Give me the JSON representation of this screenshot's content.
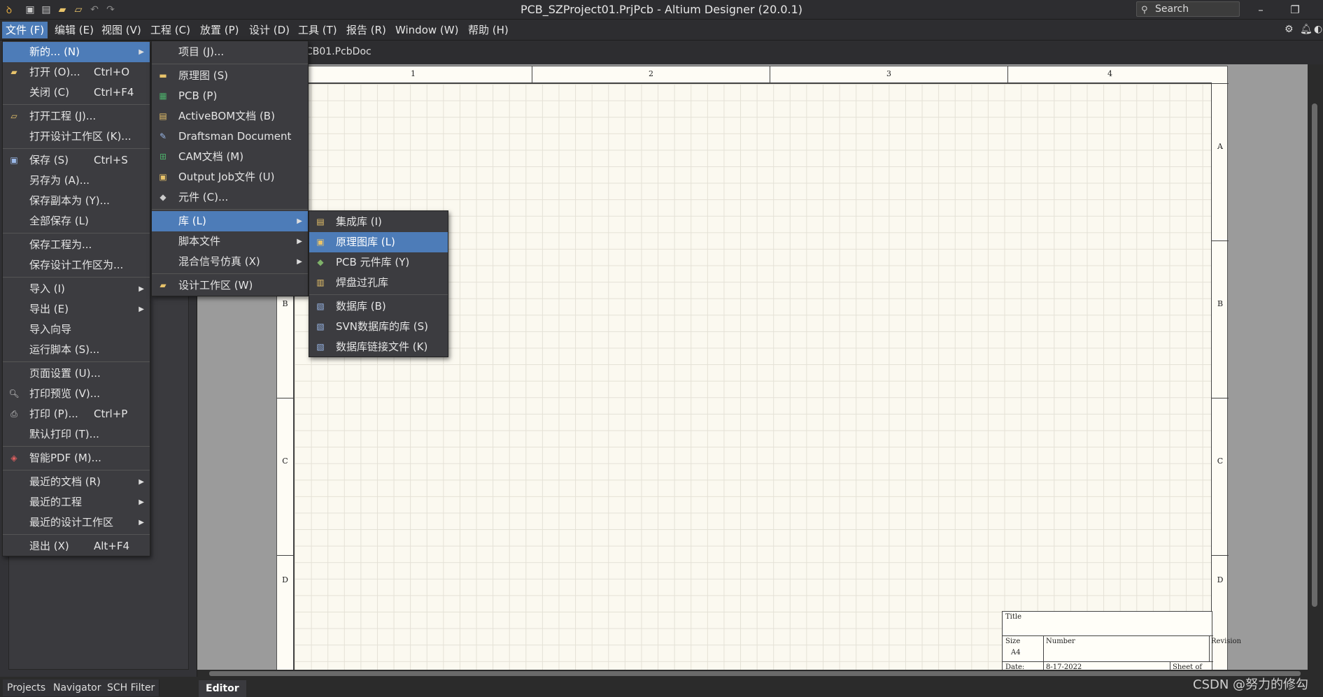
{
  "window": {
    "title": "PCB_SZProject01.PrjPcb - Altium Designer (20.0.1)",
    "search_label": "Search",
    "quick_icons": [
      "save-icon",
      "save-all-icon",
      "open-icon",
      "open-project-icon",
      "undo-icon",
      "redo-icon"
    ]
  },
  "menubar": {
    "items": [
      "文件 (F)",
      "编辑 (E)",
      "视图 (V)",
      "工程 (C)",
      "放置 (P)",
      "设计 (D)",
      "工具 (T)",
      "报告 (R)",
      "Window (W)",
      "帮助 (H)"
    ],
    "active_index": 0
  },
  "file_menu": {
    "items": [
      {
        "label": "新的... (N)",
        "shortcut": "",
        "submenu": true
      },
      {
        "label": "打开 (O)...",
        "shortcut": "Ctrl+O"
      },
      {
        "label": "关闭 (C)",
        "shortcut": "Ctrl+F4"
      },
      {
        "label": "打开工程 (J)...",
        "shortcut": ""
      },
      {
        "label": "打开设计工作区 (K)...",
        "shortcut": ""
      },
      {
        "label": "保存 (S)",
        "shortcut": "Ctrl+S"
      },
      {
        "label": "另存为 (A)...",
        "shortcut": ""
      },
      {
        "label": "保存副本为 (Y)...",
        "shortcut": ""
      },
      {
        "label": "全部保存 (L)",
        "shortcut": ""
      },
      {
        "label": "保存工程为...",
        "shortcut": ""
      },
      {
        "label": "保存设计工作区为...",
        "shortcut": ""
      },
      {
        "label": "导入 (I)",
        "shortcut": "",
        "submenu": true
      },
      {
        "label": "导出 (E)",
        "shortcut": "",
        "submenu": true
      },
      {
        "label": "导入向导",
        "shortcut": ""
      },
      {
        "label": "运行脚本 (S)...",
        "shortcut": ""
      },
      {
        "label": "页面设置 (U)...",
        "shortcut": ""
      },
      {
        "label": "打印预览 (V)...",
        "shortcut": ""
      },
      {
        "label": "打印 (P)...",
        "shortcut": "Ctrl+P"
      },
      {
        "label": "默认打印 (T)...",
        "shortcut": ""
      },
      {
        "label": "智能PDF (M)...",
        "shortcut": ""
      },
      {
        "label": "最近的文档 (R)",
        "shortcut": "",
        "submenu": true
      },
      {
        "label": "最近的工程",
        "shortcut": "",
        "submenu": true
      },
      {
        "label": "最近的设计工作区",
        "shortcut": "",
        "submenu": true
      },
      {
        "label": "退出 (X)",
        "shortcut": "Alt+F4"
      }
    ]
  },
  "new_menu": {
    "items": [
      {
        "label": "项目 (J)..."
      },
      {
        "label": "原理图 (S)"
      },
      {
        "label": "PCB (P)"
      },
      {
        "label": "ActiveBOM文档 (B)"
      },
      {
        "label": "Draftsman Document"
      },
      {
        "label": "CAM文档 (M)"
      },
      {
        "label": "Output Job文件 (U)"
      },
      {
        "label": "元件 (C)..."
      },
      {
        "label": "库 (L)"
      },
      {
        "label": "脚本文件"
      },
      {
        "label": "混合信号仿真 (X)"
      },
      {
        "label": "设计工作区 (W)"
      }
    ]
  },
  "library_menu": {
    "items": [
      {
        "label": "集成库 (I)"
      },
      {
        "label": "原理图库 (L)"
      },
      {
        "label": "PCB 元件库 (Y)"
      },
      {
        "label": "焊盘过孔库"
      },
      {
        "label": "数据库 (B)"
      },
      {
        "label": "SVN数据库的库 (S)"
      },
      {
        "label": "数据库链接文件 (K)"
      }
    ]
  },
  "document": {
    "tab_label": "CB01.PcbDoc",
    "zones_top": [
      "1",
      "2",
      "3",
      "4"
    ],
    "zones_side": [
      "A",
      "B",
      "C",
      "D"
    ],
    "title_block": {
      "title": "Title",
      "size": "Size",
      "size_value": "A4",
      "number": "Number",
      "revision": "Revision",
      "date": "Date:",
      "date_value": "8-17-2022",
      "sheet": "Sheet  of"
    }
  },
  "panel_tabs": [
    "Projects",
    "Navigator",
    "SCH Filter"
  ],
  "editor_tab": "Editor",
  "watermark": "CSDN @努力的修勾"
}
